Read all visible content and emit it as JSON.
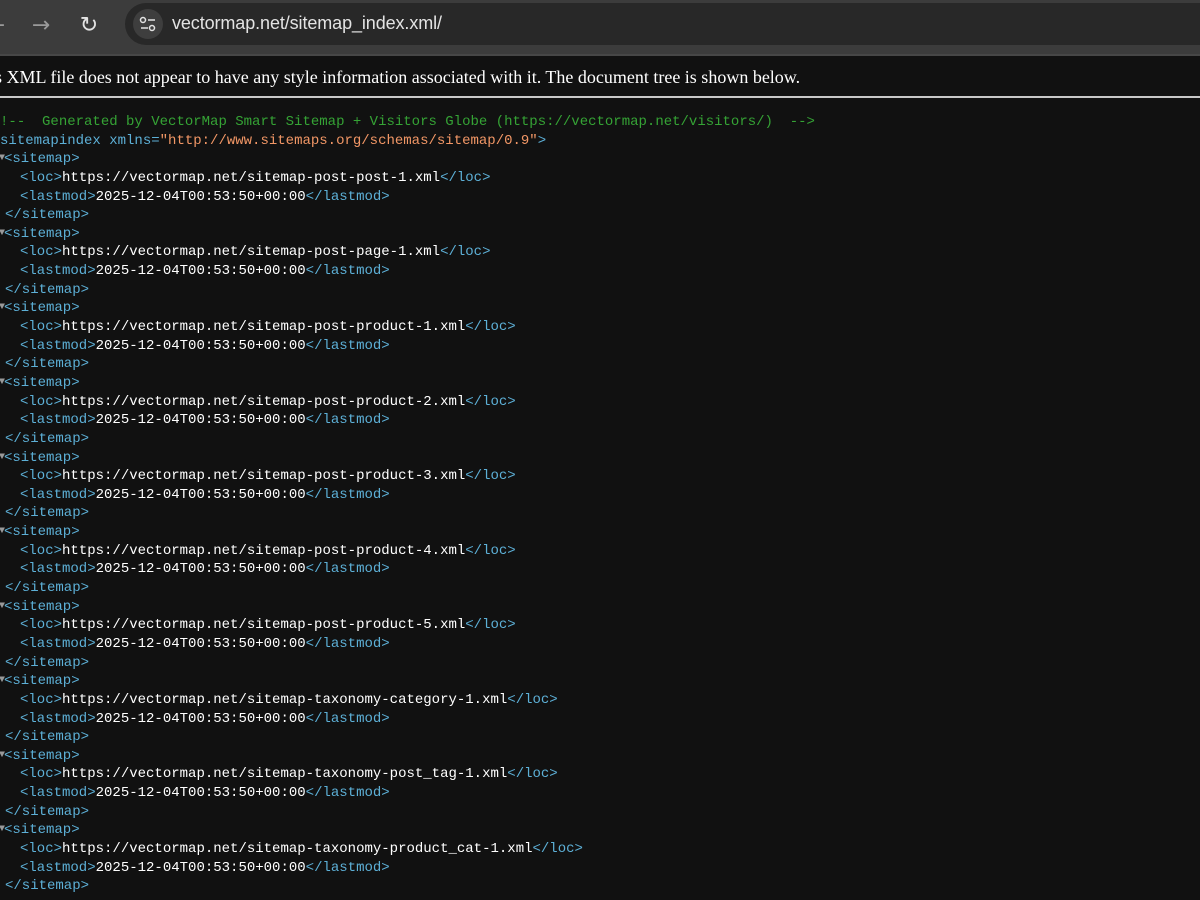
{
  "browser": {
    "url": "vectormap.net/sitemap_index.xml/",
    "back_icon": "arrow-left-icon",
    "forward_icon": "arrow-right-icon",
    "reload_icon": "reload-icon",
    "site_info_icon": "tune-icon"
  },
  "notice": "This XML file does not appear to have any style information associated with it. The document tree is shown below.",
  "xml": {
    "comment": "<!--  Generated by VectorMap Smart Sitemap + Visitors Globe (https://vectormap.net/visitors/)  -->",
    "root_open": "<sitemapindex",
    "root_attr_name": " xmlns=",
    "root_attr_value": "\"http://www.sitemaps.org/schemas/sitemap/0.9\"",
    "root_close_bracket": ">",
    "sitemap_open": "<sitemap>",
    "sitemap_close": "</sitemap>",
    "loc_open": "<loc>",
    "loc_close": "</loc>",
    "lastmod_open": "<lastmod>",
    "lastmod_close": "</lastmod>",
    "entries": [
      {
        "loc": "https://vectormap.net/sitemap-post-post-1.xml",
        "lastmod": "2025-12-04T00:53:50+00:00"
      },
      {
        "loc": "https://vectormap.net/sitemap-post-page-1.xml",
        "lastmod": "2025-12-04T00:53:50+00:00"
      },
      {
        "loc": "https://vectormap.net/sitemap-post-product-1.xml",
        "lastmod": "2025-12-04T00:53:50+00:00"
      },
      {
        "loc": "https://vectormap.net/sitemap-post-product-2.xml",
        "lastmod": "2025-12-04T00:53:50+00:00"
      },
      {
        "loc": "https://vectormap.net/sitemap-post-product-3.xml",
        "lastmod": "2025-12-04T00:53:50+00:00"
      },
      {
        "loc": "https://vectormap.net/sitemap-post-product-4.xml",
        "lastmod": "2025-12-04T00:53:50+00:00"
      },
      {
        "loc": "https://vectormap.net/sitemap-post-product-5.xml",
        "lastmod": "2025-12-04T00:53:50+00:00"
      },
      {
        "loc": "https://vectormap.net/sitemap-taxonomy-category-1.xml",
        "lastmod": "2025-12-04T00:53:50+00:00"
      },
      {
        "loc": "https://vectormap.net/sitemap-taxonomy-post_tag-1.xml",
        "lastmod": "2025-12-04T00:53:50+00:00"
      },
      {
        "loc": "https://vectormap.net/sitemap-taxonomy-product_cat-1.xml",
        "lastmod": "2025-12-04T00:53:50+00:00"
      }
    ]
  }
}
